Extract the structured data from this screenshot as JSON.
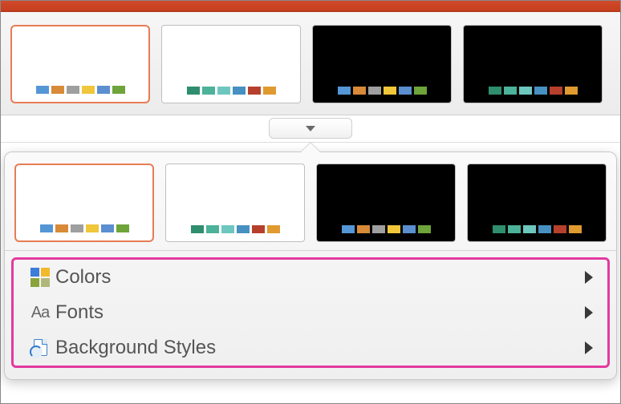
{
  "variants": {
    "top": [
      {
        "bg": "white",
        "selected": true,
        "colors": [
          "#5596d6",
          "#d88a38",
          "#9f9f9f",
          "#f0c63a",
          "#5b8fd0",
          "#6ea43a"
        ]
      },
      {
        "bg": "white",
        "selected": false,
        "colors": [
          "#2f8e6d",
          "#4cb29a",
          "#6dc7be",
          "#4790c2",
          "#b7402c",
          "#e09a2f"
        ]
      },
      {
        "bg": "black",
        "selected": false,
        "colors": [
          "#5596d6",
          "#d88a38",
          "#9f9f9f",
          "#f0c63a",
          "#5b8fd0",
          "#6ea43a"
        ]
      },
      {
        "bg": "black",
        "selected": false,
        "colors": [
          "#2f8e6d",
          "#4cb29a",
          "#6dc7be",
          "#4790c2",
          "#b7402c",
          "#e09a2f"
        ]
      }
    ],
    "popup": [
      {
        "bg": "white",
        "selected": true,
        "colors": [
          "#5596d6",
          "#d88a38",
          "#9f9f9f",
          "#f0c63a",
          "#5b8fd0",
          "#6ea43a"
        ]
      },
      {
        "bg": "white",
        "selected": false,
        "colors": [
          "#2f8e6d",
          "#4cb29a",
          "#6dc7be",
          "#4790c2",
          "#b7402c",
          "#e09a2f"
        ]
      },
      {
        "bg": "black",
        "selected": false,
        "colors": [
          "#5596d6",
          "#d88a38",
          "#9f9f9f",
          "#f0c63a",
          "#5b8fd0",
          "#6ea43a"
        ]
      },
      {
        "bg": "black",
        "selected": false,
        "colors": [
          "#2f8e6d",
          "#4cb29a",
          "#6dc7be",
          "#4790c2",
          "#b7402c",
          "#e09a2f"
        ]
      }
    ]
  },
  "menu": {
    "colors": "Colors",
    "fonts": "Fonts",
    "background": "Background Styles"
  }
}
